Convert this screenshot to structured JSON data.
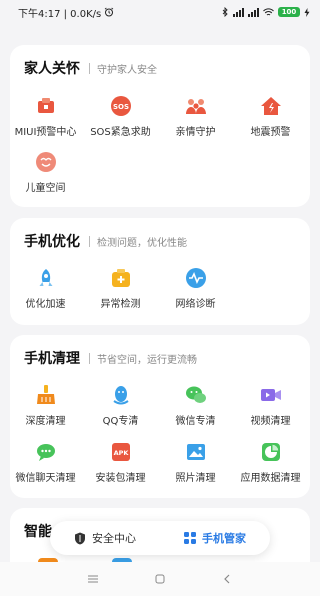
{
  "status": {
    "time_speed": "下午4:17 | 0.0K/s",
    "alarm_icon": "alarm-icon",
    "battery": "100"
  },
  "cards": {
    "care": {
      "title": "家人关怀",
      "subtitle": "守护家人安全",
      "items": [
        {
          "label": "MIUI预警中心",
          "icon": "alert-center-icon",
          "color": "#e9573f"
        },
        {
          "label": "SOS紧急求助",
          "icon": "sos-icon",
          "color": "#e9573f"
        },
        {
          "label": "亲情守护",
          "icon": "family-icon",
          "color": "#e9573f"
        },
        {
          "label": "地震预警",
          "icon": "earthquake-icon",
          "color": "#e9573f"
        },
        {
          "label": "儿童空间",
          "icon": "child-space-icon",
          "color": "#ef8a78"
        }
      ]
    },
    "optimize": {
      "title": "手机优化",
      "subtitle": "检测问题，优化性能",
      "items": [
        {
          "label": "优化加速",
          "icon": "rocket-icon",
          "color": "#3aa0e8"
        },
        {
          "label": "异常检测",
          "icon": "medkit-icon",
          "color": "#f5b21f"
        },
        {
          "label": "网络诊断",
          "icon": "network-wave-icon",
          "color": "#3aa0e8"
        }
      ]
    },
    "clean": {
      "title": "手机清理",
      "subtitle": "节省空间，运行更流畅",
      "items": [
        {
          "label": "深度清理",
          "icon": "broom-icon",
          "color": "#f08a1c"
        },
        {
          "label": "QQ专清",
          "icon": "qq-icon",
          "color": "#3aa0e8"
        },
        {
          "label": "微信专清",
          "icon": "wechat-icon",
          "color": "#47c35a"
        },
        {
          "label": "视频清理",
          "icon": "video-icon",
          "color": "#8a6ae8"
        },
        {
          "label": "微信聊天清理",
          "icon": "wechat-chat-icon",
          "color": "#47c35a"
        },
        {
          "label": "安装包清理",
          "icon": "apk-icon",
          "color": "#e9573f"
        },
        {
          "label": "照片清理",
          "icon": "photo-icon",
          "color": "#3aa0e8"
        },
        {
          "label": "应用数据清理",
          "icon": "app-data-icon",
          "color": "#47c35a"
        }
      ]
    },
    "smart": {
      "title": "智能"
    }
  },
  "float_bar": {
    "security_label": "安全中心",
    "manager_label": "手机管家",
    "active_color": "#2a7be4"
  }
}
